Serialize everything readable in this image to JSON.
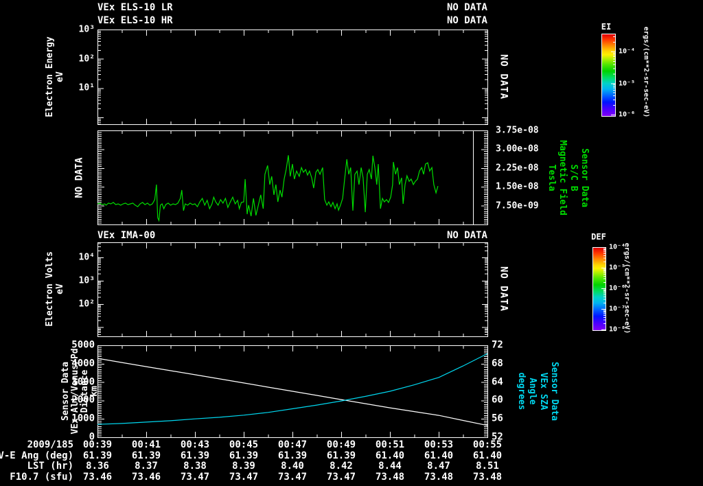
{
  "window": {
    "background": "#000000"
  },
  "panels": {
    "els": {
      "title_lr": "VEx ELS-10 LR",
      "title_hr": "VEx ELS-10 HR",
      "status_lr": "NO DATA",
      "status_hr": "NO DATA",
      "no_data_label": "NO DATA",
      "ylabel_lines": [
        "Electron Energy",
        "eV"
      ],
      "ytick_labels": [
        "10³",
        "10²",
        "10¹"
      ]
    },
    "mag": {
      "no_data_label": "NO DATA",
      "ytick_labels": [
        "3.75e-08",
        "3.00e-08",
        "2.25e-08",
        "1.50e-08",
        "7.50e-09"
      ],
      "right_label_lines": [
        "Sensor Data",
        "S/C B",
        "Magnetic Field",
        "Tesla"
      ],
      "line_color": "#00dd00",
      "label_color": "#00dd00"
    },
    "ima": {
      "title": "VEx IMA-00",
      "status": "NO DATA",
      "no_data_label": "NO DATA",
      "ylabel_lines": [
        "Electron Volts",
        "eV"
      ],
      "ytick_labels": [
        "10⁴",
        "10³",
        "10²"
      ]
    },
    "orbit": {
      "left_label_lines": [
        "Sensor Data",
        "VEx Alt/Venus/Pd",
        "Distance",
        "km"
      ],
      "right_label_lines": [
        "Sensor Data",
        "VEx SZA",
        "Angle",
        "degrees"
      ],
      "left_tick_labels": [
        "5000",
        "4000",
        "3000",
        "2000",
        "1000",
        "0"
      ],
      "right_tick_labels": [
        "72",
        "68",
        "64",
        "60",
        "56",
        "52"
      ],
      "altitude_color": "#ffffff",
      "sza_color": "#00d8f0",
      "label_color": "#00d8f0"
    }
  },
  "colorbars": {
    "els": {
      "label": "EI",
      "tick_labels": [
        "10⁻⁴",
        "10⁻⁵",
        "10⁻⁶"
      ],
      "units": "ergs/(cm**2-sr-sec-eV)"
    },
    "ima": {
      "label": "DEF",
      "tick_labels": [
        "10⁻⁴",
        "10⁻⁵",
        "10⁻⁶",
        "10⁻⁷",
        "10⁻⁸"
      ],
      "units": "ergs/(cm**2-sr-sec-eV)"
    }
  },
  "xaxis": {
    "date": "2009/185",
    "time_labels": [
      "00:39",
      "00:41",
      "00:43",
      "00:45",
      "00:47",
      "00:49",
      "00:51",
      "00:53",
      "00:55"
    ]
  },
  "table": {
    "rows": [
      {
        "label": "V-E Ang (deg)",
        "values": [
          "61.39",
          "61.39",
          "61.39",
          "61.39",
          "61.39",
          "61.39",
          "61.40",
          "61.40",
          "61.40"
        ]
      },
      {
        "label": "LST (hr)",
        "values": [
          "8.36",
          "8.37",
          "8.38",
          "8.39",
          "8.40",
          "8.42",
          "8.44",
          "8.47",
          "8.51"
        ]
      },
      {
        "label": "F10.7 (sfu)",
        "values": [
          "73.46",
          "73.46",
          "73.47",
          "73.47",
          "73.47",
          "73.47",
          "73.48",
          "73.48",
          "73.48"
        ]
      }
    ]
  },
  "chart_data": [
    {
      "id": "els_spectrogram_lr",
      "type": "heatmap",
      "title": "VEx ELS-10 LR",
      "status": "NO DATA",
      "ylabel": "Electron Energy (eV)",
      "yticks": [
        10,
        100,
        1000
      ],
      "values": []
    },
    {
      "id": "els_spectrogram_hr",
      "type": "heatmap",
      "title": "VEx ELS-10 HR",
      "status": "NO DATA",
      "values": []
    },
    {
      "id": "magnetic_field",
      "type": "line",
      "name": "S/C B Magnetic Field",
      "ylabel": "Tesla",
      "x_units": "minutes after 2009/185 00:39 UT",
      "y_units_note": "points are [minutes, nanotesla]; 1 nT = 1e-9 Tesla",
      "x_range_minutes": [
        0,
        16
      ],
      "ylim_tesla": [
        0,
        3.75e-08
      ],
      "points": [
        [
          0,
          8.2
        ],
        [
          0.1,
          8.5
        ],
        [
          0.2,
          7.9
        ],
        [
          0.3,
          8.2
        ],
        [
          0.35,
          7.7
        ],
        [
          0.45,
          8.5
        ],
        [
          0.55,
          8.2
        ],
        [
          0.65,
          8.8
        ],
        [
          0.75,
          7.9
        ],
        [
          0.85,
          8.2
        ],
        [
          0.95,
          7.7
        ],
        [
          1.05,
          8.2
        ],
        [
          1.15,
          8.5
        ],
        [
          1.25,
          7.9
        ],
        [
          1.35,
          8.2
        ],
        [
          1.45,
          8.5
        ],
        [
          1.55,
          7.7
        ],
        [
          1.65,
          7.1
        ],
        [
          1.75,
          8.2
        ],
        [
          1.85,
          8.8
        ],
        [
          1.95,
          7.9
        ],
        [
          2.05,
          8.5
        ],
        [
          2.15,
          7.7
        ],
        [
          2.25,
          8.2
        ],
        [
          2.35,
          9.9
        ],
        [
          2.42,
          15.9
        ],
        [
          2.47,
          2.7
        ],
        [
          2.52,
          1.6
        ],
        [
          2.58,
          7.7
        ],
        [
          2.65,
          8.2
        ],
        [
          2.72,
          6.3
        ],
        [
          2.8,
          7.9
        ],
        [
          2.9,
          8.5
        ],
        [
          3.0,
          7.7
        ],
        [
          3.1,
          8.2
        ],
        [
          3.2,
          7.9
        ],
        [
          3.3,
          8.5
        ],
        [
          3.4,
          10.4
        ],
        [
          3.46,
          13.7
        ],
        [
          3.53,
          5.5
        ],
        [
          3.6,
          8.2
        ],
        [
          3.7,
          7.7
        ],
        [
          3.8,
          8.5
        ],
        [
          3.9,
          7.9
        ],
        [
          4.0,
          8.2
        ],
        [
          4.1,
          7.1
        ],
        [
          4.2,
          9.0
        ],
        [
          4.3,
          10.4
        ],
        [
          4.4,
          7.7
        ],
        [
          4.5,
          9.6
        ],
        [
          4.6,
          6.3
        ],
        [
          4.7,
          8.2
        ],
        [
          4.77,
          10.9
        ],
        [
          4.85,
          9.0
        ],
        [
          4.95,
          7.7
        ],
        [
          5.05,
          9.9
        ],
        [
          5.15,
          8.5
        ],
        [
          5.25,
          10.4
        ],
        [
          5.35,
          6.8
        ],
        [
          5.45,
          9.0
        ],
        [
          5.55,
          10.9
        ],
        [
          5.65,
          8.2
        ],
        [
          5.75,
          9.6
        ],
        [
          5.82,
          6.3
        ],
        [
          5.9,
          8.8
        ],
        [
          6.0,
          9.0
        ],
        [
          6.06,
          18.1
        ],
        [
          6.14,
          4.1
        ],
        [
          6.2,
          7.7
        ],
        [
          6.3,
          3.3
        ],
        [
          6.4,
          10.4
        ],
        [
          6.5,
          3.6
        ],
        [
          6.6,
          7.7
        ],
        [
          6.7,
          11.8
        ],
        [
          6.8,
          6.3
        ],
        [
          6.87,
          20.0
        ],
        [
          6.98,
          23.5
        ],
        [
          7.07,
          15.9
        ],
        [
          7.15,
          19.2
        ],
        [
          7.24,
          11.8
        ],
        [
          7.32,
          15.9
        ],
        [
          7.4,
          9.0
        ],
        [
          7.49,
          13.7
        ],
        [
          7.57,
          10.9
        ],
        [
          7.66,
          18.1
        ],
        [
          7.74,
          21.9
        ],
        [
          7.83,
          27.6
        ],
        [
          7.91,
          19.2
        ],
        [
          8.0,
          24.1
        ],
        [
          8.08,
          18.1
        ],
        [
          8.17,
          21.3
        ],
        [
          8.28,
          19.2
        ],
        [
          8.37,
          22.7
        ],
        [
          8.45,
          20.8
        ],
        [
          8.54,
          21.9
        ],
        [
          8.62,
          19.7
        ],
        [
          8.7,
          21.3
        ],
        [
          8.79,
          18.6
        ],
        [
          8.87,
          14.5
        ],
        [
          8.96,
          20.8
        ],
        [
          9.04,
          21.9
        ],
        [
          9.13,
          20.0
        ],
        [
          9.24,
          22.7
        ],
        [
          9.32,
          9.9
        ],
        [
          9.41,
          7.7
        ],
        [
          9.49,
          9.0
        ],
        [
          9.58,
          7.1
        ],
        [
          9.66,
          8.8
        ],
        [
          9.75,
          6.3
        ],
        [
          9.83,
          8.2
        ],
        [
          9.89,
          5.7
        ],
        [
          9.97,
          7.7
        ],
        [
          10.06,
          10.4
        ],
        [
          10.14,
          18.1
        ],
        [
          10.23,
          26.0
        ],
        [
          10.31,
          20.0
        ],
        [
          10.39,
          22.7
        ],
        [
          10.48,
          5.5
        ],
        [
          10.56,
          20.0
        ],
        [
          10.65,
          21.3
        ],
        [
          10.73,
          15.9
        ],
        [
          10.82,
          22.7
        ],
        [
          10.9,
          18.6
        ],
        [
          10.99,
          4.9
        ],
        [
          11.07,
          20.0
        ],
        [
          11.15,
          21.9
        ],
        [
          11.24,
          18.1
        ],
        [
          11.3,
          27.4
        ],
        [
          11.38,
          22.7
        ],
        [
          11.46,
          15.9
        ],
        [
          11.52,
          24.1
        ],
        [
          11.61,
          6.3
        ],
        [
          11.69,
          10.4
        ],
        [
          11.77,
          9.0
        ],
        [
          11.86,
          9.9
        ],
        [
          11.94,
          8.8
        ],
        [
          12.03,
          10.9
        ],
        [
          12.11,
          15.9
        ],
        [
          12.14,
          24.9
        ],
        [
          12.23,
          20.0
        ],
        [
          12.31,
          22.7
        ],
        [
          12.39,
          15.9
        ],
        [
          12.48,
          18.6
        ],
        [
          12.54,
          8.2
        ],
        [
          12.62,
          15.9
        ],
        [
          12.7,
          19.4
        ],
        [
          12.79,
          17.2
        ],
        [
          12.87,
          18.1
        ],
        [
          12.96,
          15.9
        ],
        [
          13.04,
          17.2
        ],
        [
          13.13,
          18.1
        ],
        [
          13.21,
          21.3
        ],
        [
          13.3,
          22.7
        ],
        [
          13.38,
          20.0
        ],
        [
          13.46,
          24.1
        ],
        [
          13.55,
          24.6
        ],
        [
          13.63,
          21.3
        ],
        [
          13.72,
          22.7
        ],
        [
          13.8,
          15.9
        ],
        [
          13.89,
          12.6
        ],
        [
          13.97,
          15.3
        ]
      ]
    },
    {
      "id": "ima_spectrogram",
      "type": "heatmap",
      "title": "VEx IMA-00",
      "status": "NO DATA",
      "ylabel": "Electron Volts (eV)",
      "yticks": [
        100,
        1000,
        10000
      ],
      "values": []
    },
    {
      "id": "vex_altitude",
      "type": "line",
      "name": "VEx Alt/Venus/Pd Distance",
      "ylabel": "km",
      "ylim": [
        0,
        5000
      ],
      "x_minutes": [
        0,
        1,
        2,
        3,
        4,
        5,
        6,
        7,
        8,
        9,
        10,
        11,
        12,
        13,
        14,
        15,
        16
      ],
      "values": [
        4290,
        4065,
        3840,
        3620,
        3400,
        3175,
        2950,
        2725,
        2500,
        2275,
        2050,
        1825,
        1600,
        1395,
        1190,
        915,
        640
      ]
    },
    {
      "id": "vex_sza",
      "type": "line",
      "name": "VEx SZA Angle",
      "ylabel": "degrees",
      "ylim": [
        52,
        72
      ],
      "x_minutes": [
        0,
        1,
        2,
        3,
        4,
        5,
        6,
        7,
        8,
        9,
        10,
        11,
        12,
        13,
        14,
        15,
        16
      ],
      "values": [
        54.8,
        55.0,
        55.3,
        55.6,
        56.0,
        56.35,
        56.8,
        57.4,
        58.2,
        59.0,
        59.9,
        60.9,
        62.0,
        63.4,
        65.0,
        67.5,
        70.2
      ]
    }
  ]
}
